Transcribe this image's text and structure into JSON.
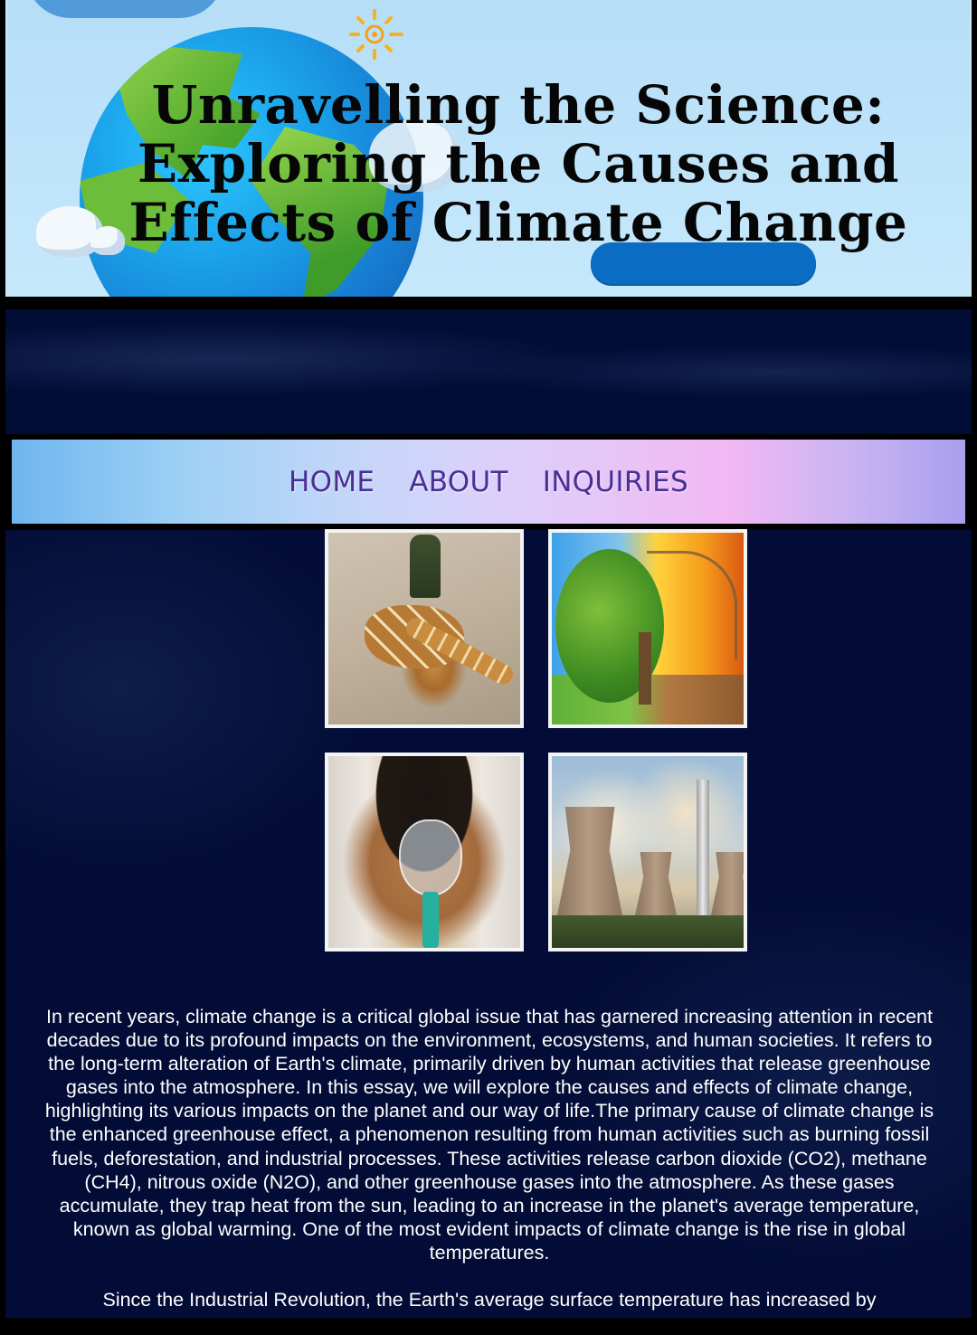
{
  "header": {
    "title": "Unravelling the Science: Exploring the Causes and Effects of Climate Change",
    "graphic": "globe-illustration",
    "accent": "#0a6cc2"
  },
  "nav": {
    "items": [
      {
        "label": "HOME"
      },
      {
        "label": "ABOUT"
      },
      {
        "label": "INQUIRIES"
      }
    ],
    "text_color": "#4a2f95"
  },
  "gallery": {
    "images": [
      {
        "subject": "drought-giraffe-photo"
      },
      {
        "subject": "dying-tree-photo"
      },
      {
        "subject": "child-oxygen-mask-photo"
      },
      {
        "subject": "cooling-towers-photo"
      }
    ]
  },
  "article": {
    "paragraphs": [
      "In recent years, climate change is a critical global issue that has garnered increasing attention in recent decades due to its profound impacts on the environment, ecosystems, and human societies. It refers to the long-term alteration of Earth's climate, primarily driven by human activities that release greenhouse gases into the atmosphere. In this essay, we will explore the causes and effects of climate change, highlighting its various impacts on the planet and our way of life.The primary cause of climate change is the enhanced greenhouse effect, a phenomenon resulting from human activities such as burning fossil fuels, deforestation, and industrial processes. These activities release carbon dioxide (CO2), methane (CH4), nitrous oxide (N2O), and other greenhouse gases into the atmosphere. As these gases accumulate, they trap heat from the sun, leading to an increase in the planet's average temperature, known as global warming. One of the most evident impacts of climate change is the rise in global temperatures.",
      "Since the Industrial Revolution, the Earth's average surface temperature has increased by"
    ]
  },
  "colors": {
    "page_bg": "#020c36",
    "header_bg": "#b6def7",
    "text": "#ffffff"
  }
}
